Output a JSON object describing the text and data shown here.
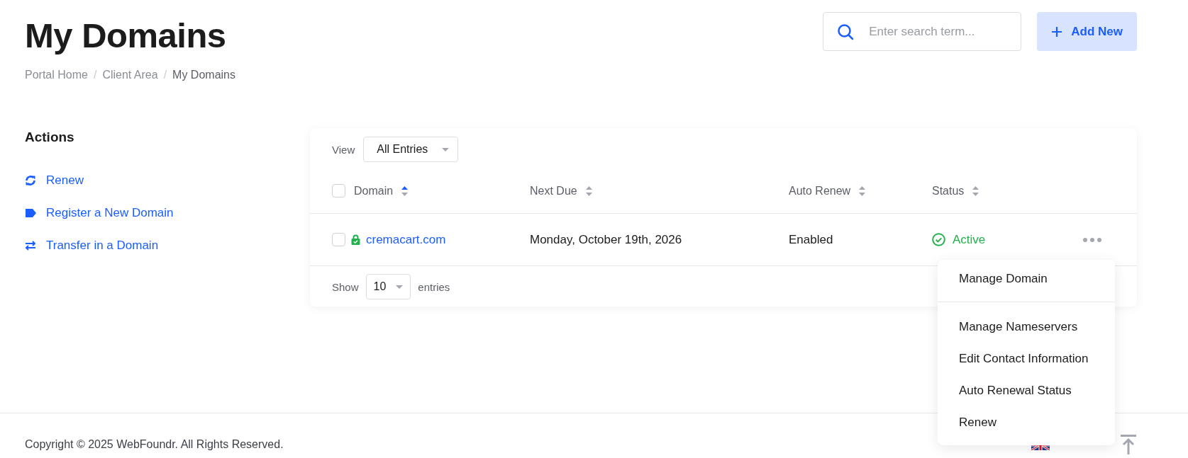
{
  "header": {
    "title": "My Domains",
    "breadcrumb_separator": "/",
    "breadcrumb": [
      {
        "label": "Portal Home",
        "current": false
      },
      {
        "label": "Client Area",
        "current": false
      },
      {
        "label": "My Domains",
        "current": true
      }
    ],
    "search": {
      "placeholder": "Enter search term..."
    },
    "add_button": "Add New"
  },
  "sidebar": {
    "title": "Actions",
    "items": [
      {
        "label": "Renew",
        "kind": "renew"
      },
      {
        "label": "Register a New Domain",
        "kind": "tag"
      },
      {
        "label": "Transfer in a Domain",
        "kind": "transfer"
      }
    ]
  },
  "table": {
    "view_label": "View",
    "view_value": "All Entries",
    "select_all_checked": false,
    "columns": [
      {
        "label": "Domain",
        "sorted": true
      },
      {
        "label": "Next Due",
        "sorted": false
      },
      {
        "label": "Auto Renew",
        "sorted": false
      },
      {
        "label": "Status",
        "sorted": false
      }
    ],
    "rows": [
      {
        "checked": false,
        "domain": "cremacart.com",
        "locked": true,
        "next_due": "Monday, October 19th, 2026",
        "auto_renew": "Enabled",
        "status": "Active",
        "active": true
      }
    ],
    "show_label": "Show",
    "page_size": "10",
    "entries_label": "entries"
  },
  "menu": {
    "groups": [
      [
        "Manage Domain"
      ],
      [
        "Manage Nameservers",
        "Edit Contact Information",
        "Auto Renewal Status",
        "Renew"
      ]
    ]
  },
  "footer": {
    "copyright": "Copyright © 2025 WebFoundr. All Rights Reserved."
  }
}
